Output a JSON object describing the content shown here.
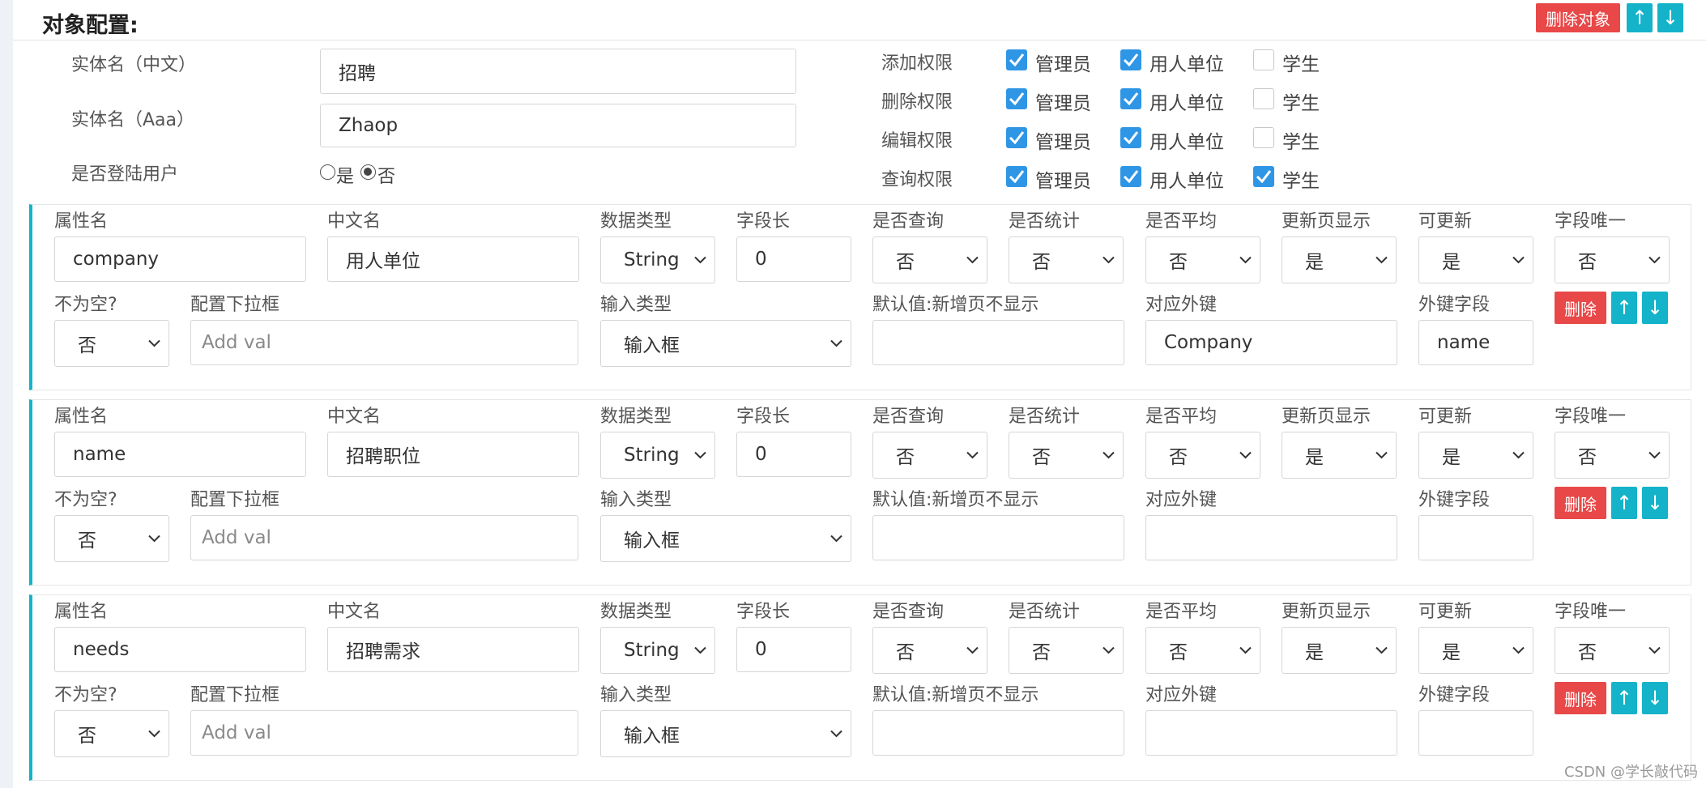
{
  "header": {
    "title": "对象配置:",
    "delete_object": "删除对象",
    "up": "↑",
    "down": "↓"
  },
  "entity": {
    "name_cn_label": "实体名（中文）",
    "name_cn_value": "招聘",
    "name_en_label": "实体名（Aaa）",
    "name_en_value": "Zhaop",
    "login_label": "是否登陆用户",
    "login_options": [
      "是",
      "否"
    ],
    "login_selected": "否"
  },
  "permissions": {
    "roles": [
      "管理员",
      "用人单位",
      "学生"
    ],
    "rows": [
      {
        "label": "添加权限",
        "checked": [
          true,
          true,
          false
        ]
      },
      {
        "label": "删除权限",
        "checked": [
          true,
          true,
          false
        ]
      },
      {
        "label": "编辑权限",
        "checked": [
          true,
          true,
          false
        ]
      },
      {
        "label": "查询权限",
        "checked": [
          true,
          true,
          true
        ]
      }
    ]
  },
  "field_labels": {
    "attr_name": "属性名",
    "cn_name": "中文名",
    "data_type": "数据类型",
    "field_len": "字段长",
    "is_query": "是否查询",
    "is_stat": "是否统计",
    "is_avg": "是否平均",
    "update_show": "更新页显示",
    "updatable": "可更新",
    "unique": "字段唯一",
    "not_null": "不为空?",
    "dropdown_cfg": "配置下拉框",
    "input_type": "输入类型",
    "default_val": "默认值:新增页不显示",
    "foreign_key": "对应外键",
    "fk_field": "外键字段",
    "delete": "删除",
    "up": "↑",
    "down": "↓",
    "add_val_placeholder": "Add val"
  },
  "fields": [
    {
      "attr": "company",
      "cn": "用人单位",
      "type": "String",
      "len": "0",
      "query": "否",
      "stat": "否",
      "avg": "否",
      "update_show": "是",
      "updatable": "是",
      "unique": "否",
      "not_null": "否",
      "input_type": "输入框",
      "default": "",
      "fk": "Company",
      "fk_field": "name"
    },
    {
      "attr": "name",
      "cn": "招聘职位",
      "type": "String",
      "len": "0",
      "query": "否",
      "stat": "否",
      "avg": "否",
      "update_show": "是",
      "updatable": "是",
      "unique": "否",
      "not_null": "否",
      "input_type": "输入框",
      "default": "",
      "fk": "",
      "fk_field": ""
    },
    {
      "attr": "needs",
      "cn": "招聘需求",
      "type": "String",
      "len": "0",
      "query": "否",
      "stat": "否",
      "avg": "否",
      "update_show": "是",
      "updatable": "是",
      "unique": "否",
      "not_null": "否",
      "input_type": "输入框",
      "default": "",
      "fk": "",
      "fk_field": ""
    }
  ],
  "watermark": "CSDN @学长敲代码",
  "colors": {
    "accent": "#14b3c9",
    "danger": "#e84848",
    "checkbox": "#2f96e6"
  }
}
